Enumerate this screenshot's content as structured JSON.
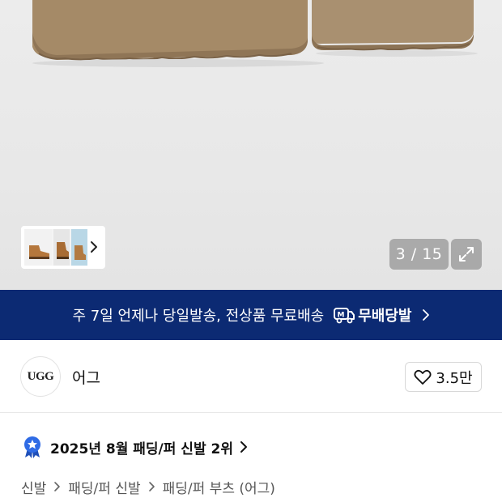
{
  "gallery": {
    "counter": "3 / 15",
    "thumbnails": [
      "boot-thumbnail",
      "boot-thumbnail",
      "boot-thumbnail"
    ]
  },
  "banner": {
    "text": "주 7일 언제나 당일발송, 전상품 무료배송",
    "brand": "무배당발",
    "colors": {
      "background": "#0c2a73",
      "text": "#ffffff"
    }
  },
  "brand": {
    "logo_text": "UGG",
    "name": "어그",
    "likes": "3.5만"
  },
  "ranking": {
    "text": "2025년 8월 패딩/퍼 신발 2위",
    "badge_color": "#2f6be5"
  },
  "breadcrumb": {
    "items": [
      "신발",
      "패딩/퍼 신발",
      "패딩/퍼 부츠 (어그)"
    ]
  }
}
